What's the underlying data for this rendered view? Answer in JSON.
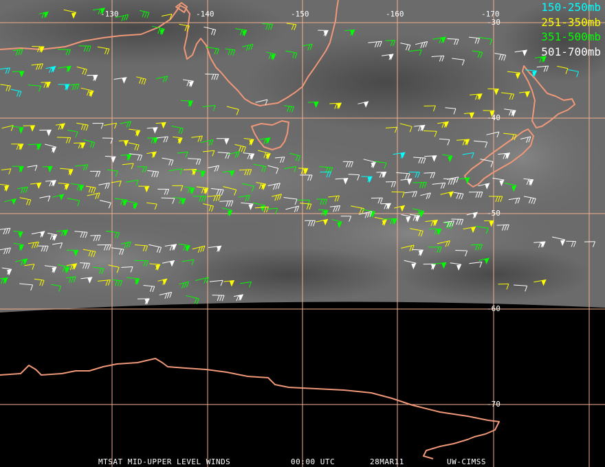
{
  "legend": [
    {
      "label": "150-250mb",
      "color": "#00ffff"
    },
    {
      "label": "251-350mb",
      "color": "#ffff00"
    },
    {
      "label": "351-500mb",
      "color": "#00ff00"
    },
    {
      "label": "501-700mb",
      "color": "#ffffff"
    }
  ],
  "longitude_labels": [
    "-130",
    "-140",
    "-150",
    "-160",
    "-170"
  ],
  "latitude_labels": [
    "-30",
    "-40",
    "-50",
    "-60",
    "-70"
  ],
  "footer": {
    "title": "MTSAT MID-UPPER LEVEL WINDS",
    "time": "00:00 UTC",
    "date": "28MAR11",
    "credit": "UW-CIMSS"
  },
  "colors": {
    "grid": "#f4b090",
    "coastline": "#f09878",
    "background": "#000000"
  }
}
